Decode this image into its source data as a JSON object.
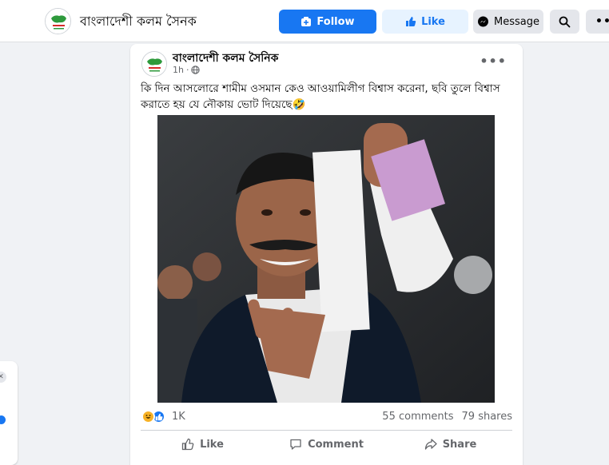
{
  "header": {
    "page_name": "বাংলাদেশী কলম সৈনক",
    "follow_label": "Follow",
    "like_label": "Like",
    "message_label": "Message",
    "colors": {
      "primary": "#1877f2",
      "primary_light": "#e7f3ff",
      "neutral": "#e4e6eb"
    }
  },
  "post": {
    "author": "বাংলাদেশী কলম সৈনিক",
    "time": "1h",
    "privacy_icon": "globe-icon",
    "text": "কি দিন আসলোরে শামীম ওসমান কেও আওয়ামিলীগ বিশ্বাস করেনা, ছবি তুলে বিশ্বাস করাতে হয় যে নৌকায় ভোট দিয়েছে🤣",
    "photo_alt": "Man holding up a ballot paper and showing a victory sign",
    "reaction_count": "1K",
    "comments": "55 comments",
    "shares": "79 shares",
    "actions": {
      "like": "Like",
      "comment": "Comment",
      "share": "Share"
    }
  }
}
